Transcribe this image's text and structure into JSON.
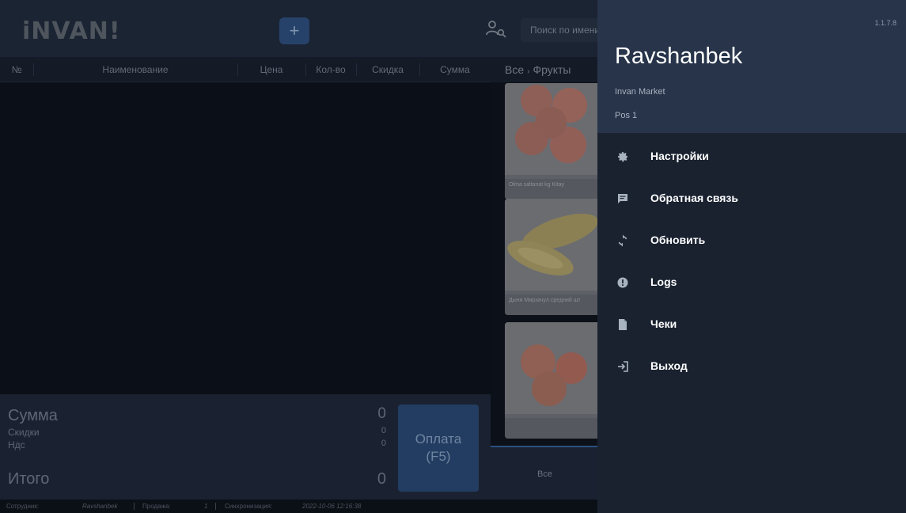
{
  "header": {
    "logo": "iNVAN!",
    "add_label": "+",
    "search_placeholder": "Поиск по имени"
  },
  "table": {
    "columns": [
      "№",
      "Наименование",
      "Цена",
      "Кол-во",
      "Скидка",
      "Сумма"
    ]
  },
  "breadcrumb": {
    "root": "Все",
    "separator": "›",
    "current": "Фрукты"
  },
  "products": [
    {
      "name": "Olma saltanat kg Kitay"
    },
    {
      "name": "Дыня Мирзачул средний шт"
    },
    {
      "name": ""
    }
  ],
  "totals": {
    "sum_label": "Сумма",
    "sum_value": "0",
    "discount_label": "Скидки",
    "discount_value": "0",
    "vat_label": "Ндс",
    "vat_value": "0",
    "total_label": "Итого",
    "total_value": "0",
    "pay_label": "Оплата",
    "pay_key": "(F5)"
  },
  "category_bar": {
    "label": "Все"
  },
  "status": {
    "employee_label": "Сотрудник:",
    "employee_value": "Ravshanbek",
    "sale_label": "Продажа:",
    "sale_value": "1",
    "sync_label": "Синхронизация:",
    "sync_value": "2022-10-06 12:16:38"
  },
  "drawer": {
    "version": "1.1.7.8",
    "user_name": "Ravshanbek",
    "store": "Invan Market",
    "pos": "Pos 1",
    "menu": [
      {
        "icon": "gear-icon",
        "label": "Настройки"
      },
      {
        "icon": "feedback-icon",
        "label": "Обратная связь"
      },
      {
        "icon": "sync-icon",
        "label": "Обновить"
      },
      {
        "icon": "alert-icon",
        "label": "Logs"
      },
      {
        "icon": "receipt-icon",
        "label": "Чеки"
      },
      {
        "icon": "logout-icon",
        "label": "Выход"
      }
    ]
  },
  "colors": {
    "drawer_bg": "#1a2230",
    "drawer_header_bg": "#27344a",
    "accent": "#2b5180"
  }
}
